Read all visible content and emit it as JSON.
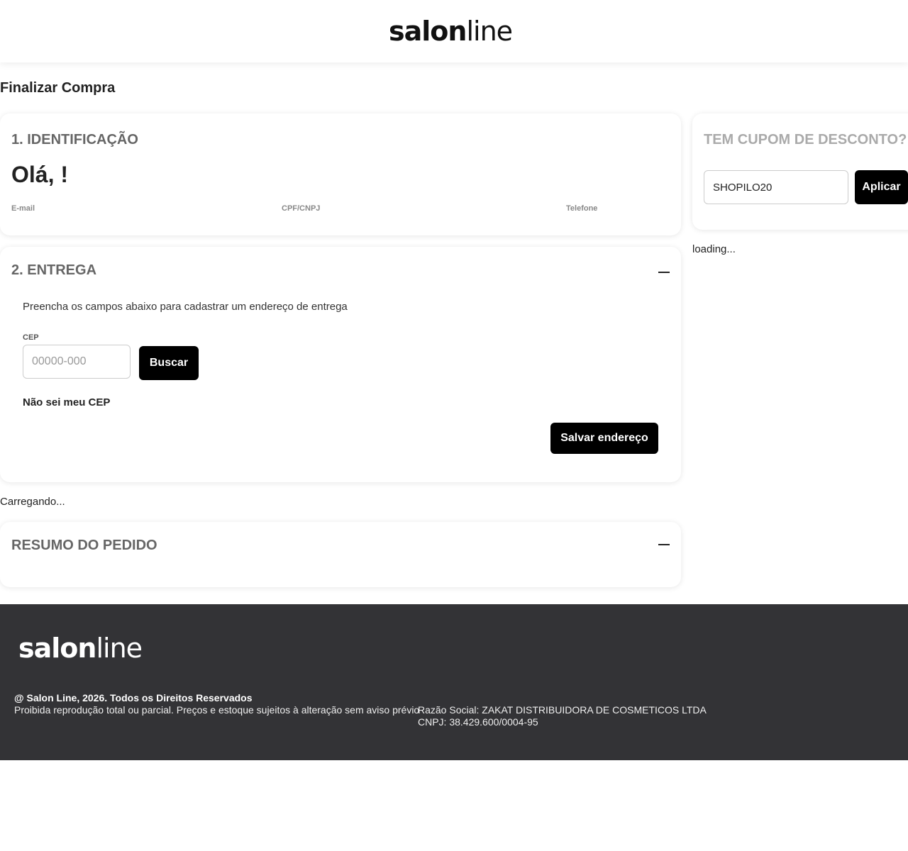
{
  "header": {
    "logo_bold": "salon",
    "logo_light": "line"
  },
  "page_title": "Finalizar Compra",
  "identificacao": {
    "title": "1. IDENTIFICAÇÃO",
    "greeting": "Olá, !",
    "email_label": "E-mail",
    "cpf_label": "CPF/CNPJ",
    "telefone_label": "Telefone"
  },
  "entrega": {
    "title": "2. ENTREGA",
    "instructions": "Preencha os campos abaixo para cadastrar um endereço de entrega",
    "cep_label": "CEP",
    "cep_placeholder": "00000-000",
    "buscar_label": "Buscar",
    "nao_sei_label": "Não sei meu CEP",
    "salvar_label": "Salvar endereço"
  },
  "carregando_text": "Carregando...",
  "resumo": {
    "title": "RESUMO DO PEDIDO"
  },
  "cupom": {
    "title": "TEM CUPOM DE DESCONTO?",
    "value": "SHOPILO20",
    "aplicar_label": "Aplicar"
  },
  "loading_text": "loading...",
  "footer": {
    "logo_bold": "salon",
    "logo_light": "line",
    "copyright": "@ Salon Line, 2026. Todos os Direitos Reservados",
    "disclaimer": "Proibida reprodução total ou parcial. Preços e estoque sujeitos à alteração sem aviso prévio",
    "razao_social": "Razão Social: ZAKAT DISTRIBUIDORA DE COSMETICOS LTDA",
    "cnpj": "CNPJ: 38.429.600/0004-95"
  }
}
